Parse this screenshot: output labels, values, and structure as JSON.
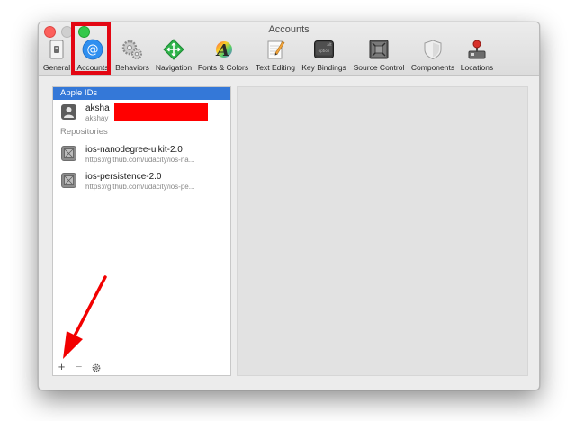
{
  "window": {
    "title": "Accounts"
  },
  "toolbar": {
    "items": [
      {
        "label": "General",
        "icon": "general-icon"
      },
      {
        "label": "Accounts",
        "icon": "at-icon",
        "selected": true
      },
      {
        "label": "Behaviors",
        "icon": "gears-icon"
      },
      {
        "label": "Navigation",
        "icon": "navigation-arrows-icon"
      },
      {
        "label": "Fonts & Colors",
        "icon": "font-color-icon"
      },
      {
        "label": "Text Editing",
        "icon": "pencil-paper-icon"
      },
      {
        "label": "Key Bindings",
        "icon": "keyboard-key-icon"
      },
      {
        "label": "Source Control",
        "icon": "source-control-icon"
      },
      {
        "label": "Components",
        "icon": "shield-icon"
      },
      {
        "label": "Locations",
        "icon": "joystick-icon"
      }
    ]
  },
  "sidebar": {
    "apple_ids_header": "Apple IDs",
    "account": {
      "name": "aksha",
      "email": "akshay"
    },
    "repositories_header": "Repositories",
    "repos": [
      {
        "name": "ios-nanodegree-uikit-2.0",
        "url": "https://github.com/udacity/ios-na..."
      },
      {
        "name": "ios-persistence-2.0",
        "url": "https://github.com/udacity/ios-pe..."
      }
    ],
    "add_label": "+",
    "remove_label": "−"
  },
  "colors": {
    "selection": "#3478d8",
    "annotation_red": "#e30613",
    "redaction": "#ff0000"
  }
}
